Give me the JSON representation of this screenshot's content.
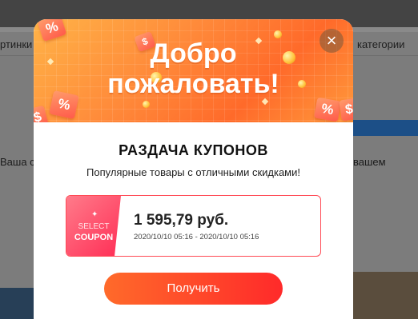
{
  "background": {
    "nav_left_text": "ртинки",
    "nav_right_text": "категории",
    "left_text": "Ваша с",
    "right_text": "вашем"
  },
  "modal": {
    "banner": {
      "title_line1": "Добро",
      "title_line2": "пожаловать!",
      "colors": {
        "gradient_start": "#ffb347",
        "gradient_end": "#ff6a2a"
      }
    },
    "close_icon": "×",
    "heading": "РАЗДАЧА КУПОНОВ",
    "subheading": "Популярные товары с отличными скидками!",
    "coupon": {
      "badge_top": "SELECT",
      "badge_main": "COUPON",
      "badge_icon": "✦",
      "amount": "1 595,79 руб.",
      "validity": "2020/10/10 05:16 - 2020/10/10 05:16",
      "accent": "#ff2d55"
    },
    "action_button": "Получить"
  },
  "deco": {
    "percent": "%",
    "dollar": "$"
  }
}
